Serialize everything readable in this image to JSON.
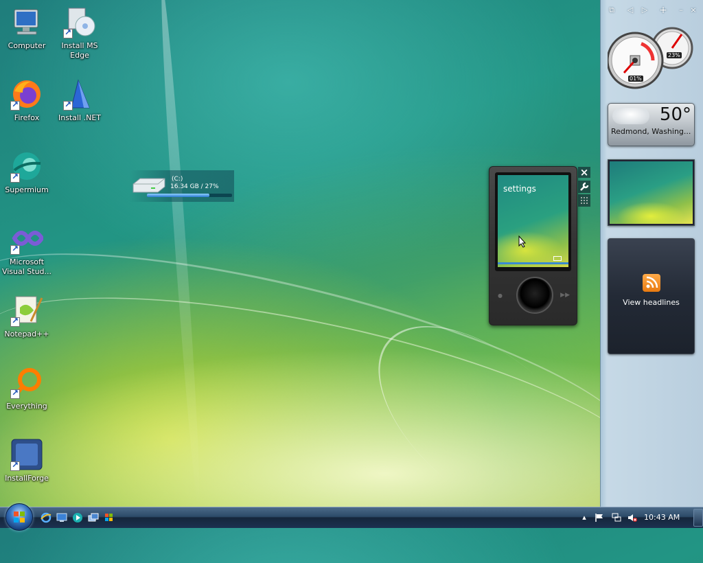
{
  "desktop": {
    "icons": [
      {
        "label": "Computer",
        "icon": "computer-icon"
      },
      {
        "label": "Install MS Edge",
        "icon": "installer-icon"
      },
      {
        "label": "Firefox",
        "icon": "firefox-icon"
      },
      {
        "label": "Install .NET",
        "icon": "dotnet-installer-icon"
      },
      {
        "label": "Supermium",
        "icon": "supermium-icon"
      },
      {
        "label": "Microsoft Visual Stud...",
        "icon": "visual-studio-icon"
      },
      {
        "label": "Notepad++",
        "icon": "notepadpp-icon"
      },
      {
        "label": "Everything",
        "icon": "everything-icon"
      },
      {
        "label": "InstallForge",
        "icon": "installforge-icon"
      }
    ]
  },
  "drive_gadget": {
    "name": "(C:)",
    "info": "16.34 GB / 27%",
    "used_fraction": 0.73
  },
  "zune_gadget": {
    "screen_title": "settings"
  },
  "sidebar": {
    "cpu_percent": "01%",
    "memory_percent": "23%",
    "weather": {
      "temp": "50°",
      "location": "Redmond, Washing..."
    },
    "feed": {
      "label": "View headlines"
    }
  },
  "taskbar": {
    "clock": "10:43 AM",
    "quick_launch": [
      "internet-explorer-icon",
      "show-desktop-icon",
      "media-player-icon",
      "switch-windows-icon",
      "windows-icon"
    ],
    "tray": [
      "show-hidden-icon",
      "action-center-flag-icon",
      "network-icon",
      "volume-muted-icon"
    ]
  }
}
